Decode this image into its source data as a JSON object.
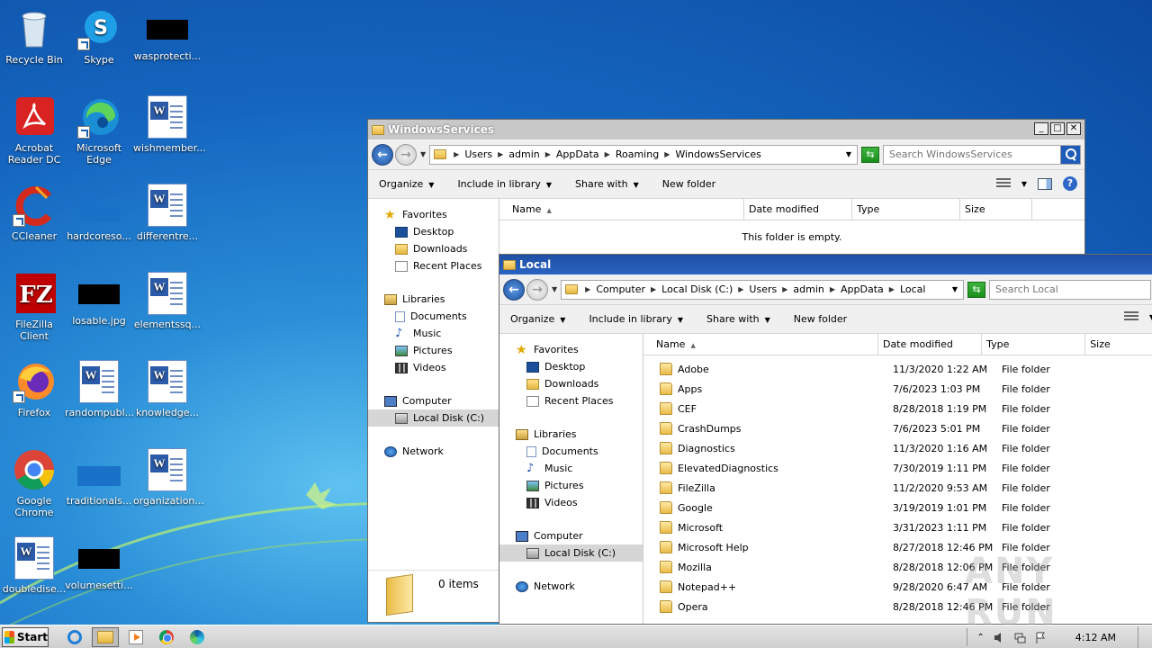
{
  "desktop": {
    "icons": [
      {
        "label": "Recycle Bin"
      },
      {
        "label": "Skype"
      },
      {
        "label": "wasprotecti..."
      },
      {
        "label": "Acrobat Reader DC"
      },
      {
        "label": "Microsoft Edge"
      },
      {
        "label": "wishmember..."
      },
      {
        "label": "CCleaner"
      },
      {
        "label": "hardcoreso..."
      },
      {
        "label": "differentre..."
      },
      {
        "label": "FileZilla Client"
      },
      {
        "label": "losable.jpg"
      },
      {
        "label": "elementssq..."
      },
      {
        "label": "Firefox"
      },
      {
        "label": "randompubl..."
      },
      {
        "label": "knowledge..."
      },
      {
        "label": "Google Chrome"
      },
      {
        "label": "traditionals..."
      },
      {
        "label": "organization..."
      },
      {
        "label": "doubledise..."
      },
      {
        "label": "volumesetti..."
      }
    ]
  },
  "window1": {
    "title": "WindowsServices",
    "breadcrumbs": [
      "Users",
      "admin",
      "AppData",
      "Roaming",
      "WindowsServices"
    ],
    "search_placeholder": "Search WindowsServices",
    "toolbar": {
      "organize": "Organize",
      "include": "Include in library",
      "share": "Share with",
      "new_folder": "New folder"
    },
    "nav": {
      "favorites": "Favorites",
      "desktop": "Desktop",
      "downloads": "Downloads",
      "recent": "Recent Places",
      "libraries": "Libraries",
      "documents": "Documents",
      "music": "Music",
      "pictures": "Pictures",
      "videos": "Videos",
      "computer": "Computer",
      "local_disk": "Local Disk (C:)",
      "network": "Network"
    },
    "columns": {
      "name": "Name",
      "date": "Date modified",
      "type": "Type",
      "size": "Size"
    },
    "empty_text": "This folder is empty.",
    "items_count": "0 items"
  },
  "window2": {
    "title": "Local",
    "breadcrumbs": [
      "Computer",
      "Local Disk (C:)",
      "Users",
      "admin",
      "AppData",
      "Local"
    ],
    "search_placeholder": "Search Local",
    "toolbar": {
      "organize": "Organize",
      "include": "Include in library",
      "share": "Share with",
      "new_folder": "New folder"
    },
    "nav": {
      "favorites": "Favorites",
      "desktop": "Desktop",
      "downloads": "Downloads",
      "recent": "Recent Places",
      "libraries": "Libraries",
      "documents": "Documents",
      "music": "Music",
      "pictures": "Pictures",
      "videos": "Videos",
      "computer": "Computer",
      "local_disk": "Local Disk (C:)",
      "network": "Network"
    },
    "columns": {
      "name": "Name",
      "date": "Date modified",
      "type": "Type",
      "size": "Size"
    },
    "rows": [
      {
        "name": "Adobe",
        "date": "11/3/2020 1:22 AM",
        "type": "File folder"
      },
      {
        "name": "Apps",
        "date": "7/6/2023 1:03 PM",
        "type": "File folder"
      },
      {
        "name": "CEF",
        "date": "8/28/2018 1:19 PM",
        "type": "File folder"
      },
      {
        "name": "CrashDumps",
        "date": "7/6/2023 5:01 PM",
        "type": "File folder"
      },
      {
        "name": "Diagnostics",
        "date": "11/3/2020 1:16 AM",
        "type": "File folder"
      },
      {
        "name": "ElevatedDiagnostics",
        "date": "7/30/2019 1:11 PM",
        "type": "File folder"
      },
      {
        "name": "FileZilla",
        "date": "11/2/2020 9:53 AM",
        "type": "File folder"
      },
      {
        "name": "Google",
        "date": "3/19/2019 1:01 PM",
        "type": "File folder"
      },
      {
        "name": "Microsoft",
        "date": "3/31/2023 1:11 PM",
        "type": "File folder"
      },
      {
        "name": "Microsoft Help",
        "date": "8/27/2018 12:46 PM",
        "type": "File folder"
      },
      {
        "name": "Mozilla",
        "date": "8/28/2018 12:06 PM",
        "type": "File folder"
      },
      {
        "name": "Notepad++",
        "date": "9/28/2020 6:47 AM",
        "type": "File folder"
      },
      {
        "name": "Opera",
        "date": "8/28/2018 12:46 PM",
        "type": "File folder"
      }
    ]
  },
  "watermark": "ANY RUN",
  "taskbar": {
    "start_label": "Start",
    "clock": "4:12 AM"
  }
}
